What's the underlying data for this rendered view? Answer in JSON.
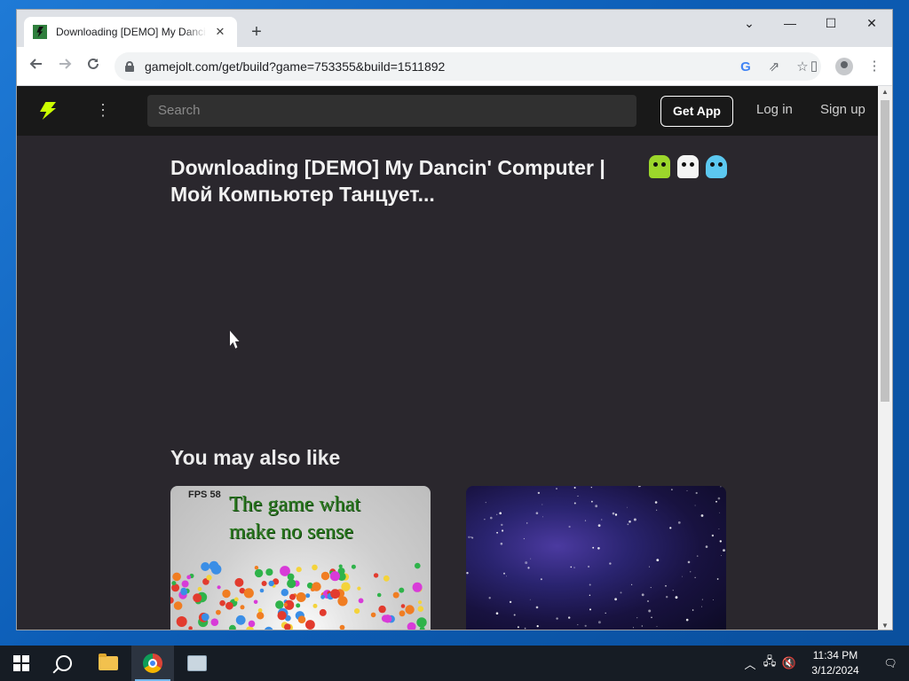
{
  "browser": {
    "tab_title": "Downloading [DEMO] My Dancin' Computer | Мой Компьютер Танцует...",
    "tab_close": "✕",
    "new_tab": "+",
    "url": "gamejolt.com/get/build?game=753355&build=1511892",
    "window_controls": {
      "tab_search": "⌄",
      "minimize": "—",
      "maximize": "☐",
      "close": "✕"
    }
  },
  "site": {
    "search_placeholder": "Search",
    "get_app_label": "Get App",
    "login_label": "Log in",
    "signup_label": "Sign up"
  },
  "page": {
    "title": "Downloading [DEMO] My Dancin' Computer | Мой Компьютер Танцует...",
    "section_heading": "You may also like"
  },
  "cards": [
    {
      "fps_label": "FPS 58",
      "thumb_text": "The game what make no sense"
    },
    {
      "thumb_text": ""
    }
  ],
  "taskbar": {
    "time": "11:34 PM",
    "date": "3/12/2024"
  },
  "icons": {
    "back": "back-arrow-icon",
    "forward": "forward-arrow-icon",
    "reload": "reload-icon",
    "google": "google-icon",
    "share": "share-icon",
    "bookmark": "star-icon",
    "side_panel": "side-panel-icon",
    "profile": "profile-icon",
    "menu": "kebab-menu-icon"
  }
}
